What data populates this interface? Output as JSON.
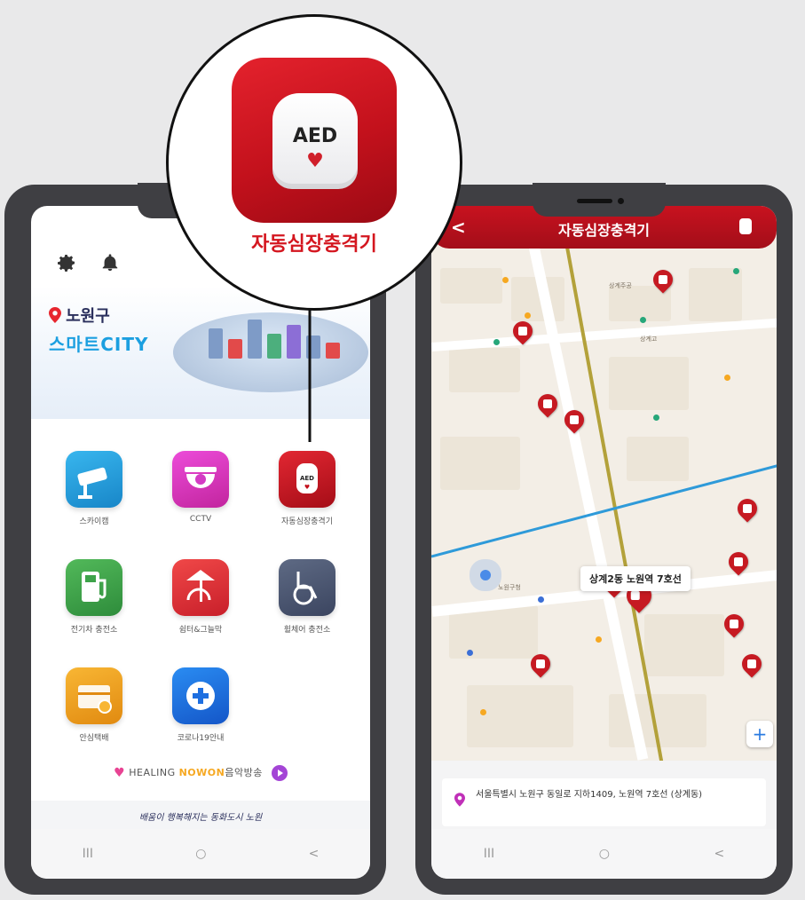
{
  "callout": {
    "icon_text": "AED",
    "label": "자동심장충격기"
  },
  "left_screen": {
    "brand": {
      "name": "노원구",
      "city": "스마트CITY"
    },
    "tiles": [
      {
        "label": "스카이캠",
        "icon": "cctv-camera-icon",
        "color": "#2aa7e0"
      },
      {
        "label": "CCTV",
        "icon": "dome-camera-icon",
        "color": "#d63acb"
      },
      {
        "label": "자동심장충격기",
        "icon": "aed-icon",
        "color": "#c3111c"
      },
      {
        "label": "전기차 충전소",
        "icon": "ev-charger-icon",
        "color": "#3ea34a"
      },
      {
        "label": "쉼터&그늘막",
        "icon": "shade-tent-icon",
        "color": "#e23b3b"
      },
      {
        "label": "휠체어 충전소",
        "icon": "wheelchair-icon",
        "color": "#4b5870"
      },
      {
        "label": "안심택배",
        "icon": "parcel-box-icon",
        "color": "#f2a11f"
      },
      {
        "label": "코로나19안내",
        "icon": "medical-plus-icon",
        "color": "#1e6fe0"
      }
    ],
    "healing": {
      "prefix": "HEALING",
      "highlight": "NOWON",
      "suffix": "음악방송"
    },
    "slogan": "배움이 행복해지는 동화도시 노원",
    "nav": [
      "III",
      "○",
      "<"
    ]
  },
  "right_screen": {
    "title": "자동심장충격기",
    "back": "<",
    "tooltip": "상계2동 노원역 7호선",
    "address": "서울특별시 노원구 동일로 지하1409, 노원역 7호선 (상계동)",
    "nav": [
      "III",
      "○",
      "<"
    ]
  }
}
